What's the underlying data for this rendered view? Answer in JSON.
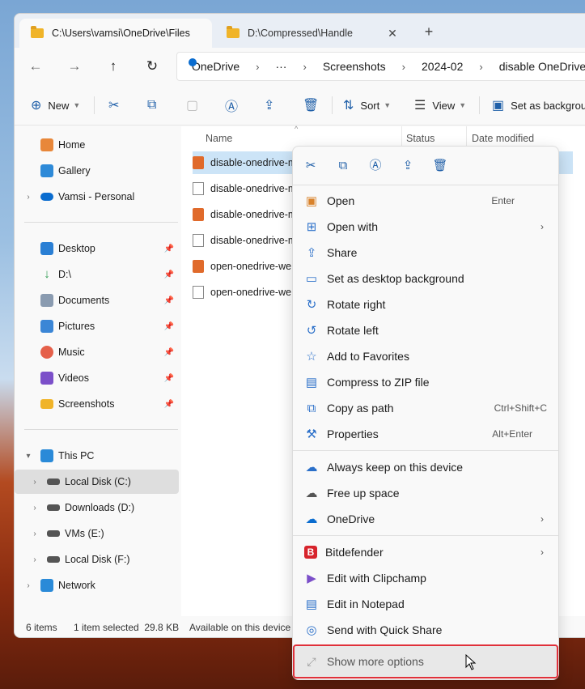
{
  "tabs": [
    {
      "label": "C:\\Users\\vamsi\\OneDrive\\Files"
    },
    {
      "label": "D:\\Compressed\\Handle",
      "close": "✕"
    }
  ],
  "new_tab": "+",
  "nav": {
    "back": "←",
    "forward": "→",
    "up": "↑",
    "refresh": "↻"
  },
  "breadcrumb": [
    "OneDrive",
    "···",
    "Screenshots",
    "2024-02",
    "disable OneDrive me"
  ],
  "breadcrumb_sep": "›",
  "toolbar": {
    "new": "New",
    "sort": "Sort",
    "view": "View",
    "set_bg": "Set as backgroun"
  },
  "sidebar": {
    "groups1": [
      {
        "label": "Home",
        "icon": "home-icon",
        "color": "#e8873a"
      },
      {
        "label": "Gallery",
        "icon": "gallery-icon",
        "color": "#2e8ad8"
      },
      {
        "label": "Vamsi - Personal",
        "icon": "onedrive-icon",
        "color": "#0a6ccf",
        "expandable": true
      }
    ],
    "pinned": [
      {
        "label": "Desktop",
        "icon": "desktop-icon",
        "color": "#2a7fd4"
      },
      {
        "label": "D:\\",
        "icon": "download-icon",
        "color": "#2e9b4f"
      },
      {
        "label": "Documents",
        "icon": "documents-icon",
        "color": "#8a9bb0"
      },
      {
        "label": "Pictures",
        "icon": "pictures-icon",
        "color": "#3b86d6"
      },
      {
        "label": "Music",
        "icon": "music-icon",
        "color": "#e5604a"
      },
      {
        "label": "Videos",
        "icon": "videos-icon",
        "color": "#7b4fc9"
      },
      {
        "label": "Screenshots",
        "icon": "folder-icon",
        "color": "#f0b429"
      }
    ],
    "pc": [
      {
        "label": "This PC",
        "icon": "pc-icon",
        "color": "#2a8ad8",
        "level": 0
      },
      {
        "label": "Local Disk (C:)",
        "icon": "drive-icon",
        "color": "#555",
        "level": 1,
        "selected": true
      },
      {
        "label": "Downloads (D:)",
        "icon": "drive-icon",
        "color": "#555",
        "level": 1
      },
      {
        "label": "VMs (E:)",
        "icon": "drive-icon",
        "color": "#555",
        "level": 1
      },
      {
        "label": "Local Disk (F:)",
        "icon": "drive-icon",
        "color": "#555",
        "level": 1
      },
      {
        "label": "Network",
        "icon": "network-icon",
        "color": "#2a8ad8",
        "level": 0
      }
    ]
  },
  "columns": {
    "name": "Name",
    "status": "Status",
    "date": "Date modified"
  },
  "files": [
    {
      "name": "disable-onedrive-m",
      "type": "jpg",
      "selected": true
    },
    {
      "name": "disable-onedrive-m",
      "type": "doc"
    },
    {
      "name": "disable-onedrive-m",
      "type": "jpg"
    },
    {
      "name": "disable-onedrive-m",
      "type": "doc"
    },
    {
      "name": "open-onedrive-we",
      "type": "jpg"
    },
    {
      "name": "open-onedrive-we",
      "type": "doc"
    }
  ],
  "statusbar": {
    "count": "6 items",
    "selected": "1 item selected  29.8 KB",
    "availability": "Available on this device"
  },
  "context_menu": {
    "quick_actions": [
      {
        "name": "cut-icon",
        "glyph": "✂"
      },
      {
        "name": "copy-icon",
        "glyph": "⧉"
      },
      {
        "name": "rename-icon",
        "glyph": "Ⓐ"
      },
      {
        "name": "share-icon",
        "glyph": "⇪"
      },
      {
        "name": "delete-icon",
        "glyph": "🗑"
      }
    ],
    "section1": [
      {
        "label": "Open",
        "accel": "Enter",
        "icon": "image-icon",
        "glyph": "▣",
        "color": "#d9822b"
      },
      {
        "label": "Open with",
        "submenu": "›",
        "icon": "open-with-icon",
        "glyph": "⊞",
        "color": "#2a6fc9"
      },
      {
        "label": "Share",
        "icon": "share-icon",
        "glyph": "⇪",
        "color": "#2a6fc9"
      },
      {
        "label": "Set as desktop background",
        "icon": "background-icon",
        "glyph": "▭",
        "color": "#2a6fc9"
      },
      {
        "label": "Rotate right",
        "icon": "rotate-right-icon",
        "glyph": "↻",
        "color": "#2a6fc9"
      },
      {
        "label": "Rotate left",
        "icon": "rotate-left-icon",
        "glyph": "↺",
        "color": "#2a6fc9"
      },
      {
        "label": "Add to Favorites",
        "icon": "star-icon",
        "glyph": "☆",
        "color": "#2a6fc9"
      },
      {
        "label": "Compress to ZIP file",
        "icon": "zip-icon",
        "glyph": "▤",
        "color": "#2a6fc9"
      },
      {
        "label": "Copy as path",
        "accel": "Ctrl+Shift+C",
        "icon": "path-icon",
        "glyph": "⧉",
        "color": "#2a6fc9"
      },
      {
        "label": "Properties",
        "accel": "Alt+Enter",
        "icon": "wrench-icon",
        "glyph": "⚒",
        "color": "#2a6fc9"
      }
    ],
    "section2": [
      {
        "label": "Always keep on this device",
        "icon": "cloud-check-icon",
        "glyph": "☁",
        "color": "#2a6fc9"
      },
      {
        "label": "Free up space",
        "icon": "cloud-icon",
        "glyph": "☁",
        "color": "#555555"
      },
      {
        "label": "OneDrive",
        "submenu": "›",
        "icon": "onedrive-icon",
        "glyph": "☁",
        "color": "#0a6ccf"
      }
    ],
    "section3": [
      {
        "label": "Bitdefender",
        "submenu": "›",
        "icon": "bitdefender-icon",
        "glyph": "B",
        "color": "#d7242c"
      },
      {
        "label": "Edit with Clipchamp",
        "icon": "clipchamp-icon",
        "glyph": "▶",
        "color": "#7b4fc9"
      },
      {
        "label": "Edit in Notepad",
        "icon": "notepad-icon",
        "glyph": "▤",
        "color": "#2a6fc9"
      },
      {
        "label": "Send with Quick Share",
        "icon": "quick-share-icon",
        "glyph": "◎",
        "color": "#2a6fc9"
      }
    ],
    "show_more": "Show more options"
  }
}
